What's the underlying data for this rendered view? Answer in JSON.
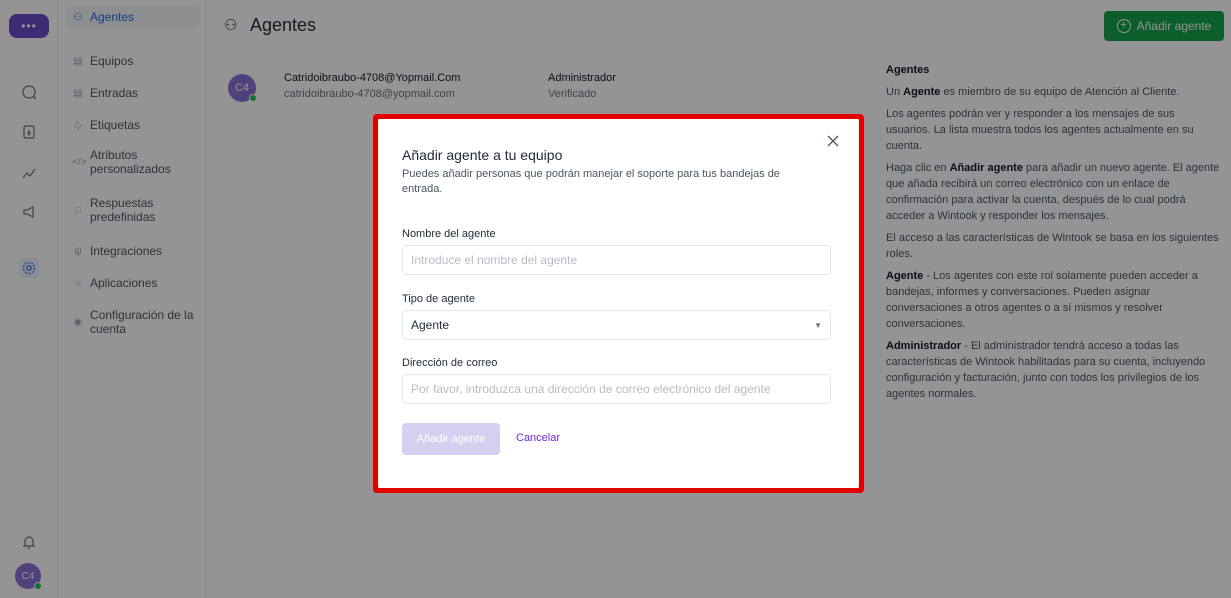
{
  "app": {
    "logo_text": "•••",
    "user_initials": "C4"
  },
  "sidebar": {
    "items": [
      {
        "label": "Agentes",
        "icon": "users-icon",
        "active": true
      },
      {
        "label": "Equipos",
        "icon": "team-icon"
      },
      {
        "label": "Entradas",
        "icon": "inbox-icon"
      },
      {
        "label": "Etiquetas",
        "icon": "tag-icon"
      },
      {
        "label": "Atributos personalizados",
        "icon": "code-icon"
      },
      {
        "label": "Respuestas predefinidas",
        "icon": "chat-icon"
      },
      {
        "label": "Integraciones",
        "icon": "plug-icon"
      },
      {
        "label": "Aplicaciones",
        "icon": "apps-icon"
      },
      {
        "label": "Configuración de la cuenta",
        "icon": "settings-icon"
      }
    ]
  },
  "header": {
    "title": "Agentes",
    "add_button": "Añadir agente"
  },
  "agents": [
    {
      "initials": "C4",
      "name": "Catridoibraubo-4708@Yopmail.Com",
      "email": "catridoibraubo-4708@yopmail.com",
      "role": "Administrador",
      "status": "Verificado"
    }
  ],
  "help": {
    "title": "Agentes",
    "p1_pre": "Un ",
    "p1_bold": "Agente",
    "p1_post": " es miembro de su equipo de Atención al Cliente.",
    "p2": "Los agentes podrán ver y responder a los mensajes de sus usuarios. La lista muestra todos los agentes actualmente en su cuenta.",
    "p3_pre": "Haga clic en ",
    "p3_bold": "Añadir agente",
    "p3_post": " para añadir un nuevo agente. El agente que añada recibirá un correo electrónico con un enlace de confirmación para activar la cuenta, después de lo cual podrá acceder a Wintook y responder los mensajes.",
    "p4": "El acceso a las características de Wintook se basa en los siguientes roles.",
    "p5_bold": "Agente",
    "p5_post": " - Los agentes con este rol solamente pueden acceder a bandejas, informes y conversaciones. Pueden asignar conversaciones a otros agentes o a sí mismos y resolver conversaciones.",
    "p6_bold": "Administrador",
    "p6_post": " - El administrador tendrá acceso a todas las características de Wintook habilitadas para su cuenta, incluyendo configuración y facturación, junto con todos los privilegios de los agentes normales."
  },
  "modal": {
    "title": "Añadir agente a tu equipo",
    "description": "Puedes añadir personas que podrán manejar el soporte para tus bandejas de entrada.",
    "name_label": "Nombre del agente",
    "name_placeholder": "Introduce el nombre del agente",
    "type_label": "Tipo de agente",
    "type_value": "Agente",
    "email_label": "Dirección de correo",
    "email_placeholder": "Por favor, introduzca una dirección de correo electrónico del agente",
    "submit": "Añadir agente",
    "cancel": "Cancelar"
  },
  "colors": {
    "accent": "#15a34a",
    "brand": "#6a4ac8",
    "highlight": "#e00000"
  }
}
